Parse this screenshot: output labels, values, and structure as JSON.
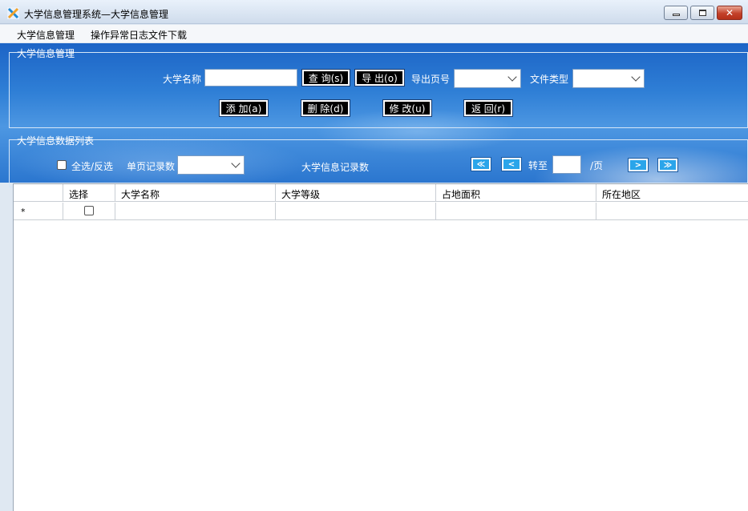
{
  "window": {
    "title": "大学信息管理系统—大学信息管理"
  },
  "menu": {
    "items": [
      "大学信息管理",
      "操作异常日志文件下载"
    ]
  },
  "query_group": {
    "legend": "大学信息管理",
    "university_name_label": "大学名称",
    "university_name_value": "",
    "buttons": {
      "query": "查 询(s)",
      "export": "导 出(o)",
      "add": "添 加(a)",
      "delete": "删 除(d)",
      "modify": "修 改(u)",
      "back": "返 回(r)"
    },
    "export_page_label": "导出页号",
    "export_page_value": "",
    "file_type_label": "文件类型",
    "file_type_value": ""
  },
  "list_group": {
    "legend": "大学信息数据列表",
    "select_all_label": "全选/反选",
    "select_all_checked": false,
    "page_size_label": "单页记录数",
    "page_size_value": "",
    "record_count_label": "大学信息记录数",
    "nav": {
      "first": "≪",
      "prev": "<",
      "next": ">",
      "last": "≫"
    },
    "goto_label": "转至",
    "goto_value": "",
    "page_suffix": "/页"
  },
  "grid": {
    "columns": [
      "",
      "选择",
      "大学名称",
      "大学等级",
      "占地面积",
      "所在地区"
    ],
    "new_row_marker": "*"
  },
  "colors": {
    "panel_blue": "#2f7fd6",
    "nav_button": "#2aa5ea",
    "close_button": "#c3412a"
  },
  "icons": [
    "app-icon",
    "minimize-icon",
    "maximize-icon",
    "close-icon",
    "dropdown-arrow-icon"
  ]
}
